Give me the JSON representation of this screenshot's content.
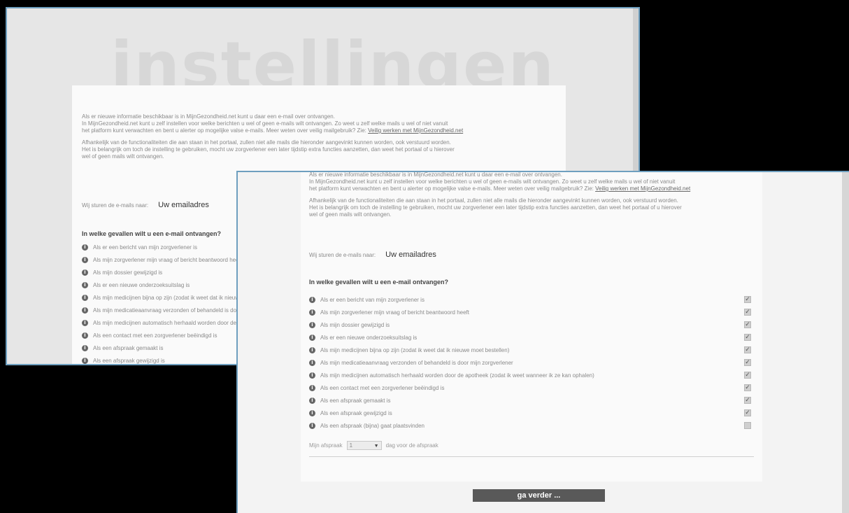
{
  "watermark": "instellingen",
  "intro": {
    "p1_line1": "Als er nieuwe informatie beschikbaar is in MijnGezondheid.net kunt u daar een e-mail over ontvangen.",
    "p1_line2": "In MijnGezondheid.net kunt u zelf instellen voor welke berichten u wel of geen e-mails wilt ontvangen. Zo weet u zelf welke mails u wel of niet vanuit",
    "p1_line3": "het platform kunt verwachten en bent u alerter op mogelijke valse e-mails. Meer weten over veilig mailgebruik? Zie:",
    "p1_link": "Veilig werken met MijnGezondheid.net",
    "p2_line1": "Afhankelijk van de functionaliteiten die aan staan in het portaal, zullen niet alle mails die hieronder aangevinkt kunnen worden, ook verstuurd worden.",
    "p2_line2": "Het is belangrijk om toch de instelling te gebruiken, mocht uw zorgverlener een later tijdstip extra functies aanzetten, dan weet het portaal of u hierover",
    "p2_line3": "wel of geen mails wilt ontvangen."
  },
  "email": {
    "label": "Wij sturen de e-mails naar:",
    "value": "Uw emailadres"
  },
  "question_title": "In welke gevallen wilt u een e-mail ontvangen?",
  "options": [
    {
      "label": "Als er een bericht van mijn zorgverlener is",
      "checked": true
    },
    {
      "label": "Als mijn zorgverlener mijn vraag of bericht beantwoord heeft",
      "checked": true
    },
    {
      "label": "Als mijn dossier gewijzigd is",
      "checked": true
    },
    {
      "label": "Als er een nieuwe onderzoeksuitslag is",
      "checked": true
    },
    {
      "label": "Als mijn medicijnen bijna op zijn (zodat ik weet dat ik nieuwe moet bestellen)",
      "checked": true
    },
    {
      "label": "Als mijn medicatieaanvraag verzonden of behandeld is door mijn zorgverlener",
      "checked": true
    },
    {
      "label": "Als mijn medicijnen automatisch herhaald worden door de apotheek (zodat ik weet wanneer ik ze kan ophalen)",
      "checked": true
    },
    {
      "label": "Als een contact met een zorgverlener beëindigd is",
      "checked": true
    },
    {
      "label": "Als een afspraak gemaakt is",
      "checked": true
    },
    {
      "label": "Als een afspraak gewijzigd is",
      "checked": true
    },
    {
      "label": "Als een afspraak (bijna) gaat plaatsvinden",
      "checked": false
    }
  ],
  "back_options": [
    "Als er een bericht van mijn zorgverlener is",
    "Als mijn zorgverlener mijn vraag of bericht beantwoord heeft",
    "Als mijn dossier gewijzigd is",
    "Als er een nieuwe onderzoeksuitslag is",
    "Als mijn medicijnen bijna op zijn (zodat ik weet dat ik nieuwe moet bestellen)",
    "Als mijn medicatieaanvraag verzonden of behandeld is door mijn zorgverlener",
    "Als mijn medicijnen automatisch herhaald worden door de apotheek",
    "Als een contact met een zorgverlener beëindigd is",
    "Als een afspraak gemaakt is",
    "Als een afspraak gewijzigd is"
  ],
  "frequency": {
    "prefix": "Mijn afspraak",
    "select_value": "1",
    "suffix": "dag voor de afspraak"
  },
  "next_button": "ga verder ..."
}
